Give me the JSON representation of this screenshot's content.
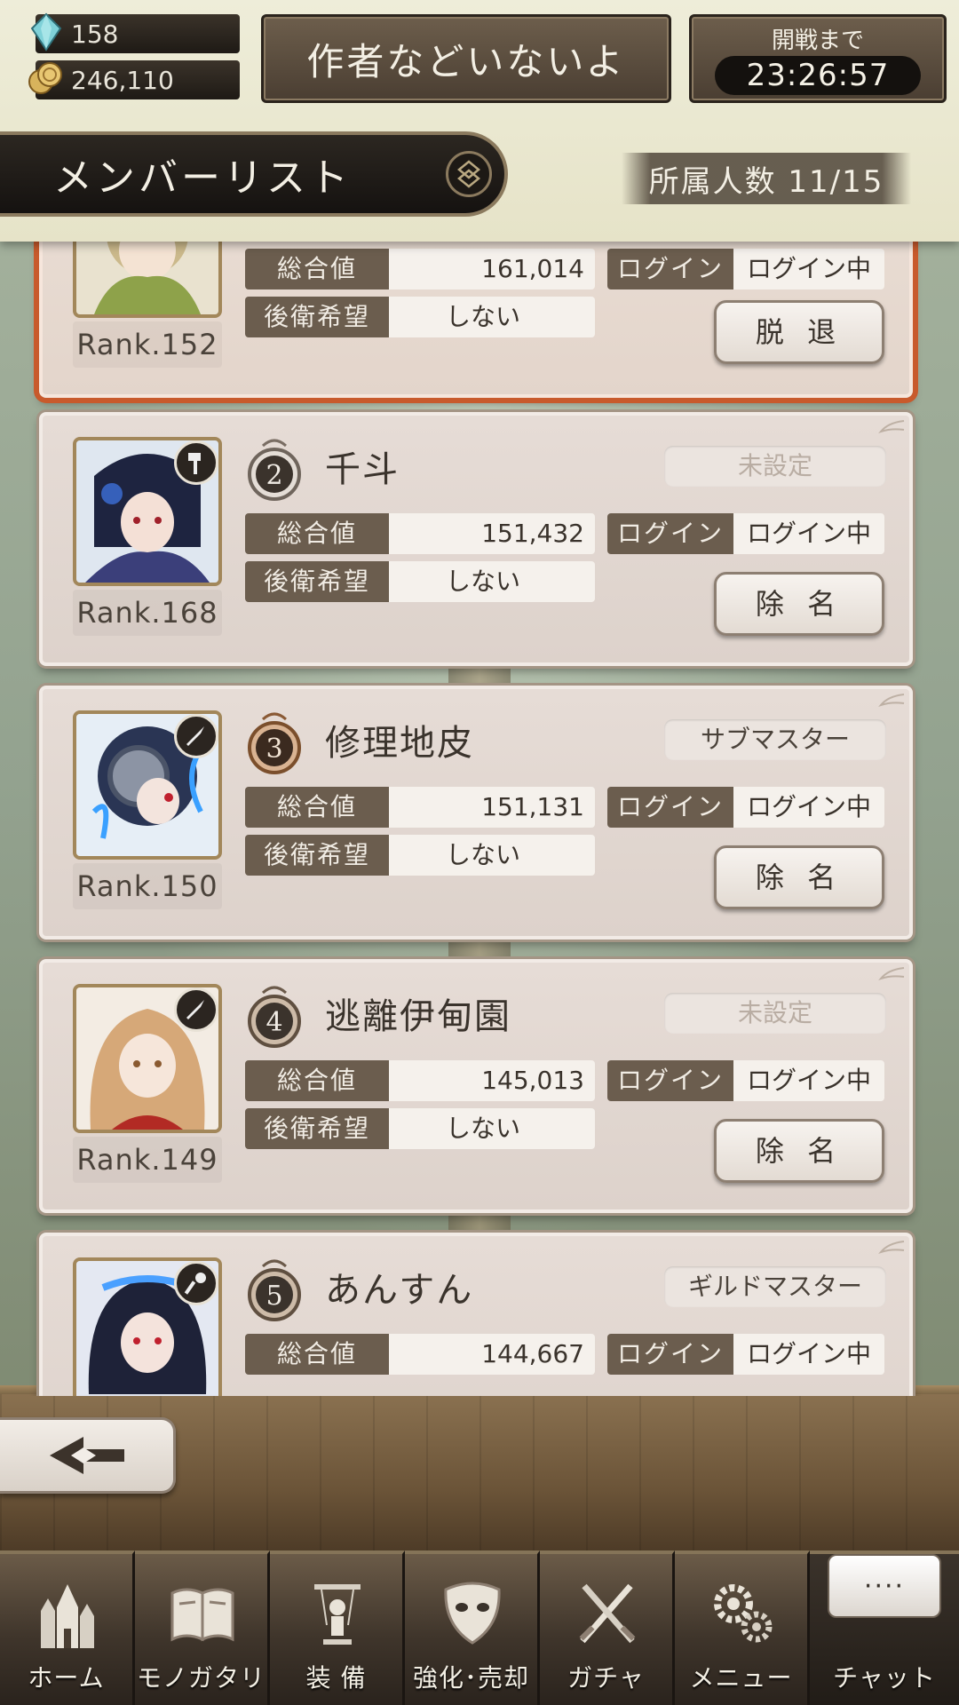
{
  "header": {
    "crystals": "158",
    "gold": "246,110",
    "guild_name": "作者などいないよ",
    "battle_label": "開戦まで",
    "battle_timer": "23:26:57",
    "title": "メンバーリスト",
    "member_count": "所属人数 11/15"
  },
  "members": [
    {
      "rank_label": "Rank.152",
      "total_key": "総合値",
      "total_value": "161,014",
      "login_key": "ログイン",
      "login_value": "ログイン中",
      "rear_key": "後衛希望",
      "rear_value": "しない",
      "action": "脱 退"
    },
    {
      "position": "2",
      "name": "千斗",
      "role": "未設定",
      "rank_label": "Rank.168",
      "total_key": "総合値",
      "total_value": "151,432",
      "login_key": "ログイン",
      "login_value": "ログイン中",
      "rear_key": "後衛希望",
      "rear_value": "しない",
      "action": "除 名"
    },
    {
      "position": "3",
      "name": "修理地皮",
      "role": "サブマスター",
      "rank_label": "Rank.150",
      "total_key": "総合値",
      "total_value": "151,131",
      "login_key": "ログイン",
      "login_value": "ログイン中",
      "rear_key": "後衛希望",
      "rear_value": "しない",
      "action": "除 名"
    },
    {
      "position": "4",
      "name": "逃離伊甸園",
      "role": "未設定",
      "rank_label": "Rank.149",
      "total_key": "総合値",
      "total_value": "145,013",
      "login_key": "ログイン",
      "login_value": "ログイン中",
      "rear_key": "後衛希望",
      "rear_value": "しない",
      "action": "除 名"
    },
    {
      "position": "5",
      "name": "あんすん",
      "role": "ギルドマスター",
      "total_key": "総合値",
      "total_value": "144,667",
      "login_key": "ログイン",
      "login_value": "ログイン中"
    }
  ],
  "nav": [
    {
      "label": "ホーム",
      "icon": "castle-icon"
    },
    {
      "label": "モノガタリ",
      "icon": "book-icon"
    },
    {
      "label": "装 備",
      "icon": "puppet-icon"
    },
    {
      "label": "強化･売却",
      "icon": "mask-icon"
    },
    {
      "label": "ガチャ",
      "icon": "swords-icon"
    },
    {
      "label": "メニュー",
      "icon": "gears-icon"
    },
    {
      "label": "チャット",
      "icon": "chat-bubble-icon",
      "bubble": "····"
    }
  ],
  "colors": {
    "self_border": "#c85a2c",
    "card_bg": "#e3d8d1",
    "stat_key_bg": "#6b5d4e",
    "header_bg": "#eeedd9"
  }
}
